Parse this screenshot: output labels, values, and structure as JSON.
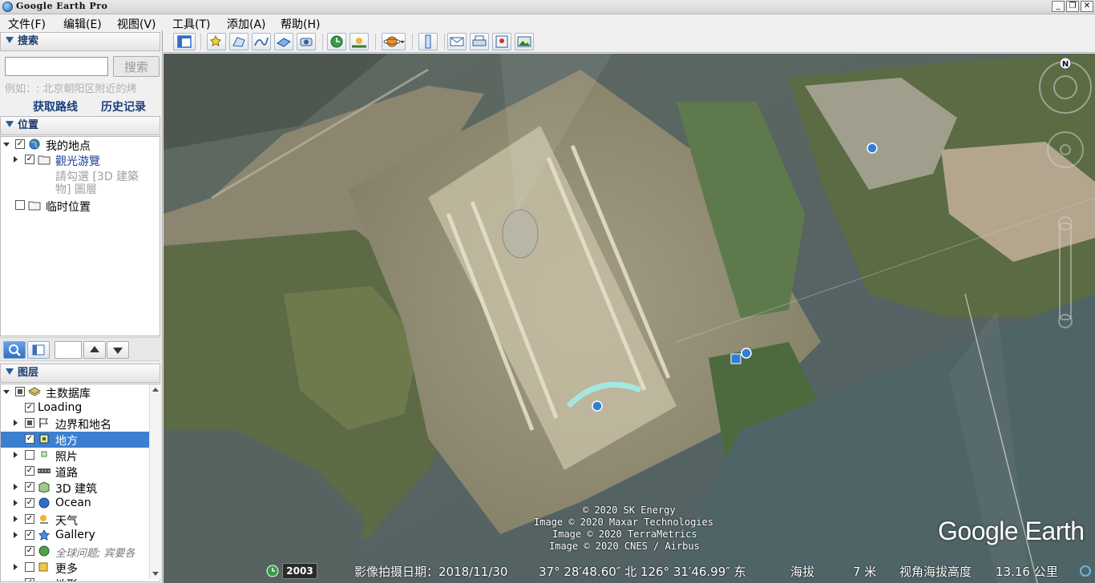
{
  "window": {
    "title": "Google Earth Pro",
    "minimize": "_",
    "restore": "❐",
    "close": "✕"
  },
  "menu": [
    "文件(F)",
    "编辑(E)",
    "视图(V)",
    "工具(T)",
    "添加(A)",
    "帮助(H)"
  ],
  "search": {
    "header": "搜索",
    "input_value": "",
    "button": "搜索",
    "hint": "例如：: 北京朝阳区附近的烤",
    "links": [
      "获取路线",
      "历史记录"
    ]
  },
  "places": {
    "header": "位置",
    "items": [
      {
        "label": "我的地点",
        "checked": true,
        "icon": "earth-icon"
      },
      {
        "label": "觀光游覽",
        "checked": true,
        "icon": "folder-icon"
      },
      {
        "label": "請勾選 [3D 建築物] 圖層",
        "checked": null,
        "icon": ""
      },
      {
        "label": "临时位置",
        "checked": false,
        "icon": "folder-icon"
      }
    ],
    "tour_hint_line1": "請勾選 [3D 建築",
    "tour_hint_line2": "物] 圖層"
  },
  "layers": {
    "header": "图层",
    "items": [
      {
        "label": "主数据库",
        "icon": "layers-icon"
      },
      {
        "label": "Loading",
        "icon": ""
      },
      {
        "label": "边界和地名",
        "icon": "flag-icon"
      },
      {
        "label": "地方",
        "icon": "place-icon"
      },
      {
        "label": "照片",
        "icon": "photo-icon"
      },
      {
        "label": "道路",
        "icon": "road-icon"
      },
      {
        "label": "3D 建筑",
        "icon": "building-icon"
      },
      {
        "label": "Ocean",
        "icon": "ocean-icon"
      },
      {
        "label": "天气",
        "icon": "weather-icon"
      },
      {
        "label": "Gallery",
        "icon": "star-icon"
      },
      {
        "label": "全球问题; 宾要各",
        "icon": "globe-icon"
      },
      {
        "label": "更多",
        "icon": "folder-icon"
      },
      {
        "label": "地形",
        "icon": ""
      }
    ]
  },
  "map": {
    "credits": [
      "© 2020 SK Energy",
      "Image © 2020 Maxar Technologies",
      "Image © 2020 TerraMetrics",
      "Image © 2020 CNES / Airbus"
    ],
    "brand": "Google Earth",
    "year_badge": "2003",
    "status": {
      "imagery_date": "影像拍摄日期：2018/11/30",
      "coords": "37° 28′48.60″ 北 126° 31′46.99″ 东",
      "elevation_label": "海拔",
      "elevation_value": "7 米",
      "eye_alt_label": "视角海拔高度",
      "eye_alt_value": "13.16 公里"
    },
    "compass_north": "N"
  }
}
